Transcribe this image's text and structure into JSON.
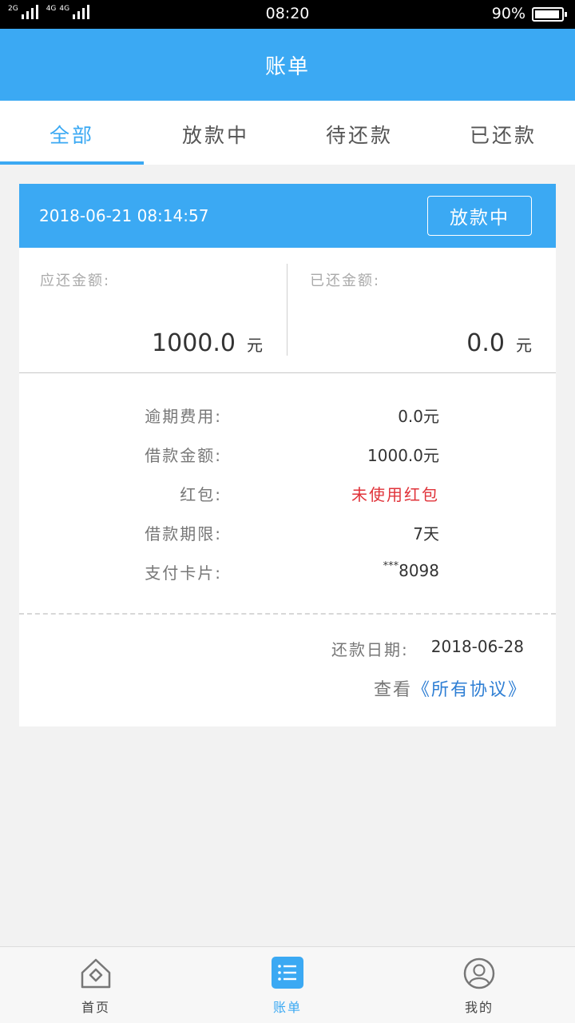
{
  "status_bar": {
    "network_1": "2G",
    "network_2": "4G",
    "network_3": "4G",
    "time": "08:20",
    "battery_percent": "90%"
  },
  "header": {
    "title": "账单"
  },
  "tabs": [
    {
      "label": "全部",
      "active": true
    },
    {
      "label": "放款中",
      "active": false
    },
    {
      "label": "待还款",
      "active": false
    },
    {
      "label": "已还款",
      "active": false
    }
  ],
  "bill": {
    "datetime": "2018-06-21 08:14:57",
    "status": "放款中",
    "due_label": "应还金额:",
    "due_amount": "1000.0",
    "due_unit": "元",
    "paid_label": "已还金额:",
    "paid_amount": "0.0",
    "paid_unit": "元",
    "details": [
      {
        "label": "逾期费用:",
        "value": "0.0元"
      },
      {
        "label": "借款金额:",
        "value": "1000.0元"
      },
      {
        "label": "红包:",
        "value": "未使用红包"
      },
      {
        "label": "借款期限:",
        "value": "7天"
      },
      {
        "label": "支付卡片:",
        "value_prefix": "***",
        "value": "8098"
      }
    ],
    "repay_date_label": "还款日期:",
    "repay_date": "2018-06-28",
    "agreement_prefix": "查看",
    "agreement_link": "《所有协议》"
  },
  "bottom_nav": [
    {
      "label": "首页",
      "icon": "home-icon",
      "active": false
    },
    {
      "label": "账单",
      "icon": "bill-list-icon",
      "active": true
    },
    {
      "label": "我的",
      "icon": "user-profile-icon",
      "active": false
    }
  ],
  "colors": {
    "primary": "#3ba9f3",
    "link": "#2f7fd4",
    "highlight_red": "#e0333a",
    "background": "#f2f2f2"
  }
}
